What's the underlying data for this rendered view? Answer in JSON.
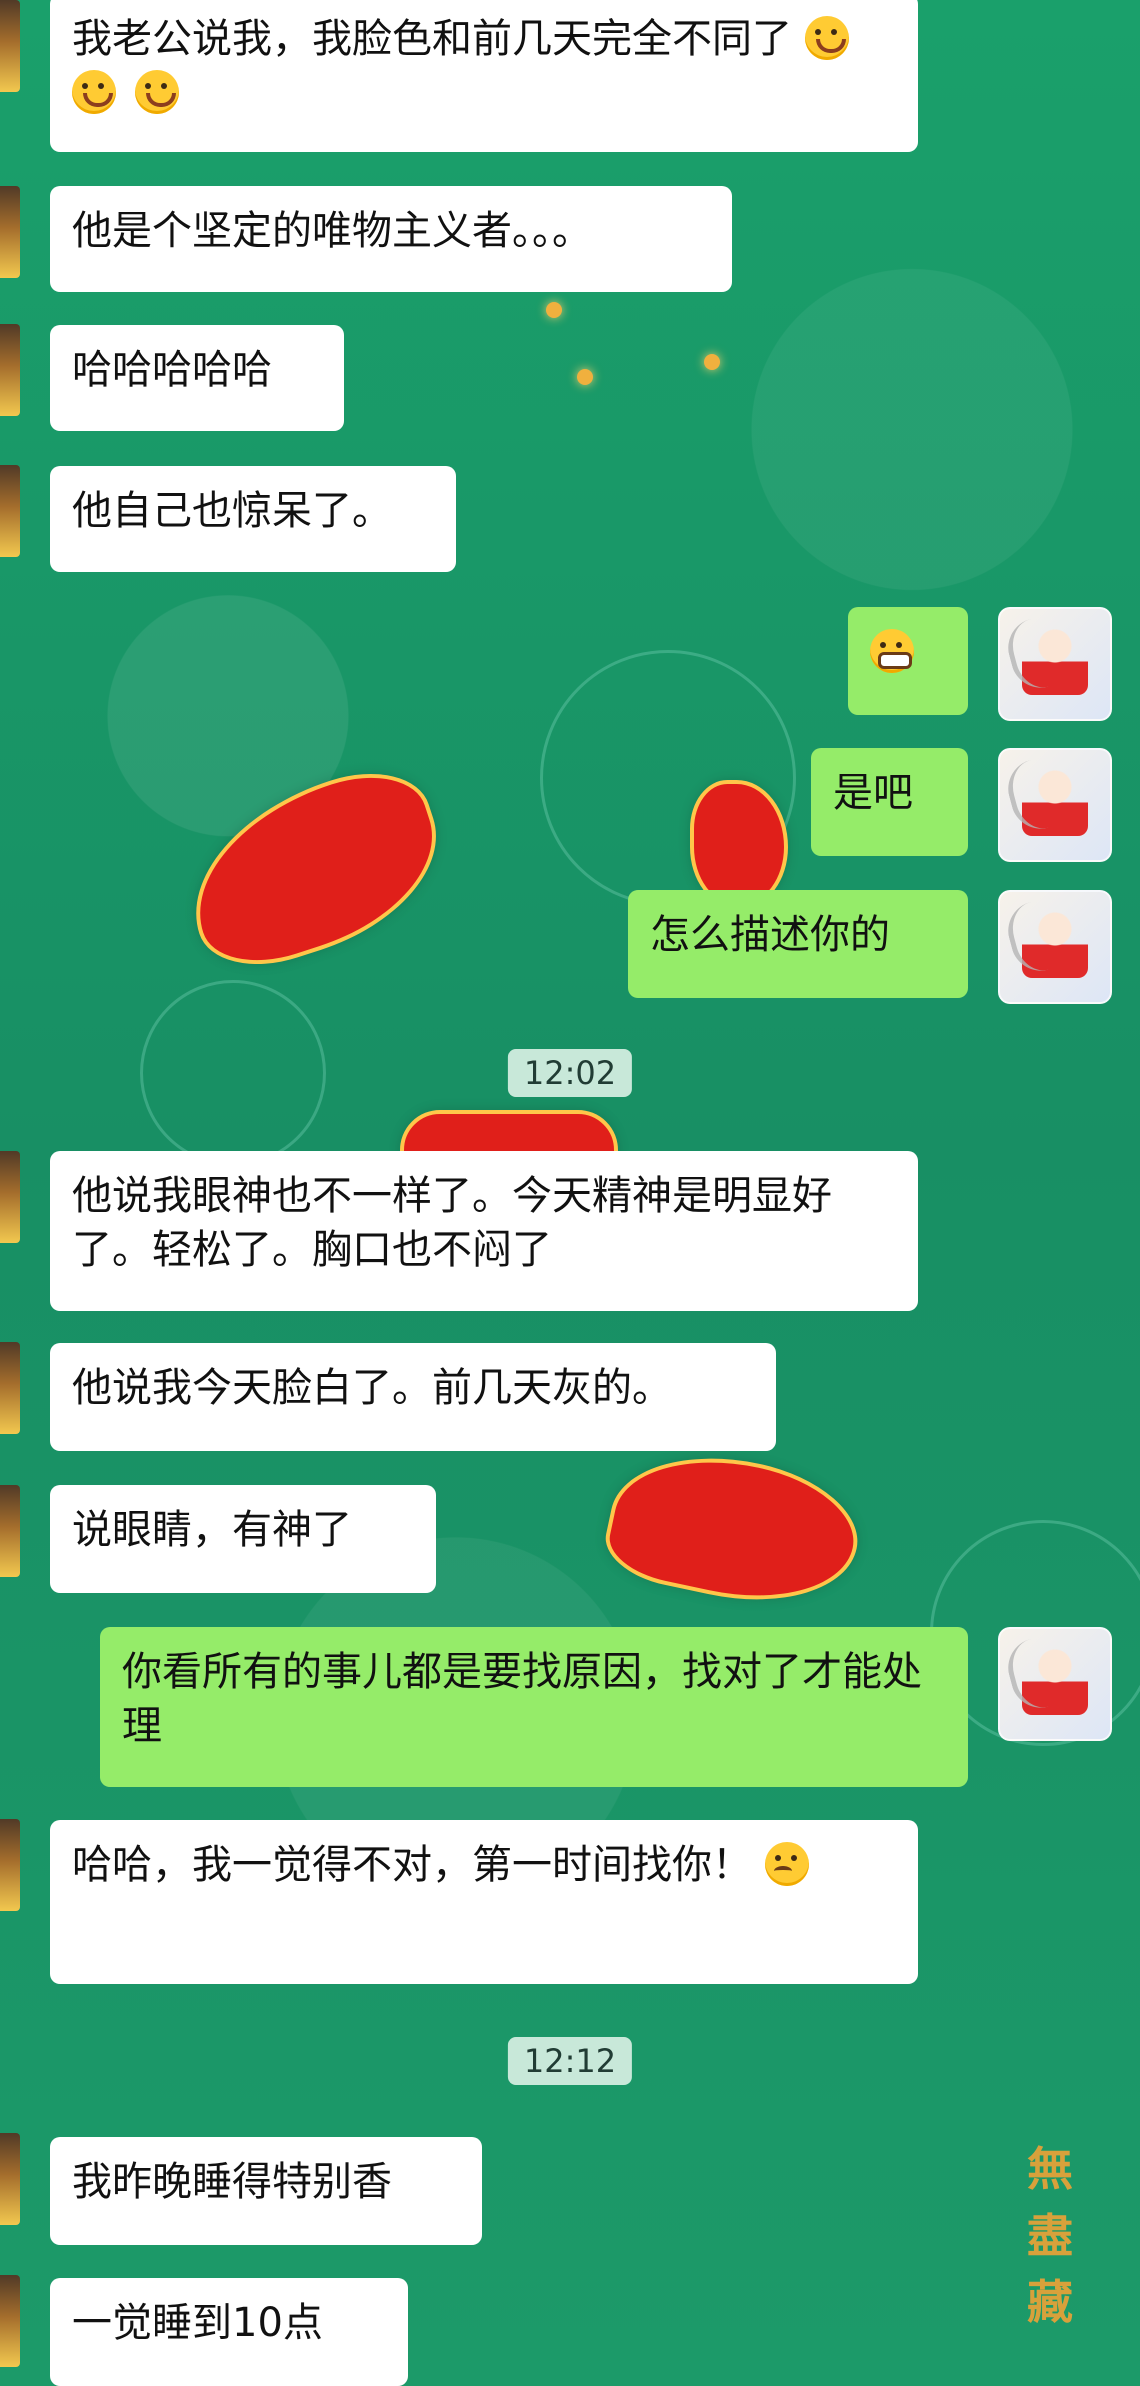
{
  "chat": {
    "messages": [
      {
        "side": "left",
        "text": "我老公说我，我脸色和前几天完全不同了",
        "emoji": [
          "laugh",
          "laugh",
          "laugh"
        ]
      },
      {
        "side": "left",
        "text": "他是个坚定的唯物主义者。。。",
        "emoji": []
      },
      {
        "side": "left",
        "text": "哈哈哈哈哈",
        "emoji": []
      },
      {
        "side": "left",
        "text": "他自己也惊呆了。",
        "emoji": []
      },
      {
        "side": "right",
        "text": "",
        "emoji": [
          "grin"
        ]
      },
      {
        "side": "right",
        "text": "是吧",
        "emoji": []
      },
      {
        "side": "right",
        "text": "怎么描述你的",
        "emoji": []
      },
      {
        "side": "time",
        "text": "12:02"
      },
      {
        "side": "left",
        "text": "他说我眼神也不一样了。今天精神是明显好了。轻松了。胸口也不闷了",
        "emoji": []
      },
      {
        "side": "left",
        "text": "他说我今天脸白了。前几天灰的。",
        "emoji": []
      },
      {
        "side": "left",
        "text": "说眼睛，有神了",
        "emoji": []
      },
      {
        "side": "right",
        "text": "你看所有的事儿都是要找原因，找对了才能处理",
        "emoji": []
      },
      {
        "side": "left",
        "text": "哈哈，我一觉得不对，第一时间找你！",
        "emoji": [
          "think"
        ]
      },
      {
        "side": "time",
        "text": "12:12"
      },
      {
        "side": "left",
        "text": "我昨晚睡得特别香",
        "emoji": []
      },
      {
        "side": "left",
        "text": "一觉睡到10点",
        "emoji": []
      }
    ]
  },
  "watermark": "無盡藏",
  "colors": {
    "left_bubble": "#ffffff",
    "right_bubble": "#95ec69",
    "background": "#1b9466"
  }
}
